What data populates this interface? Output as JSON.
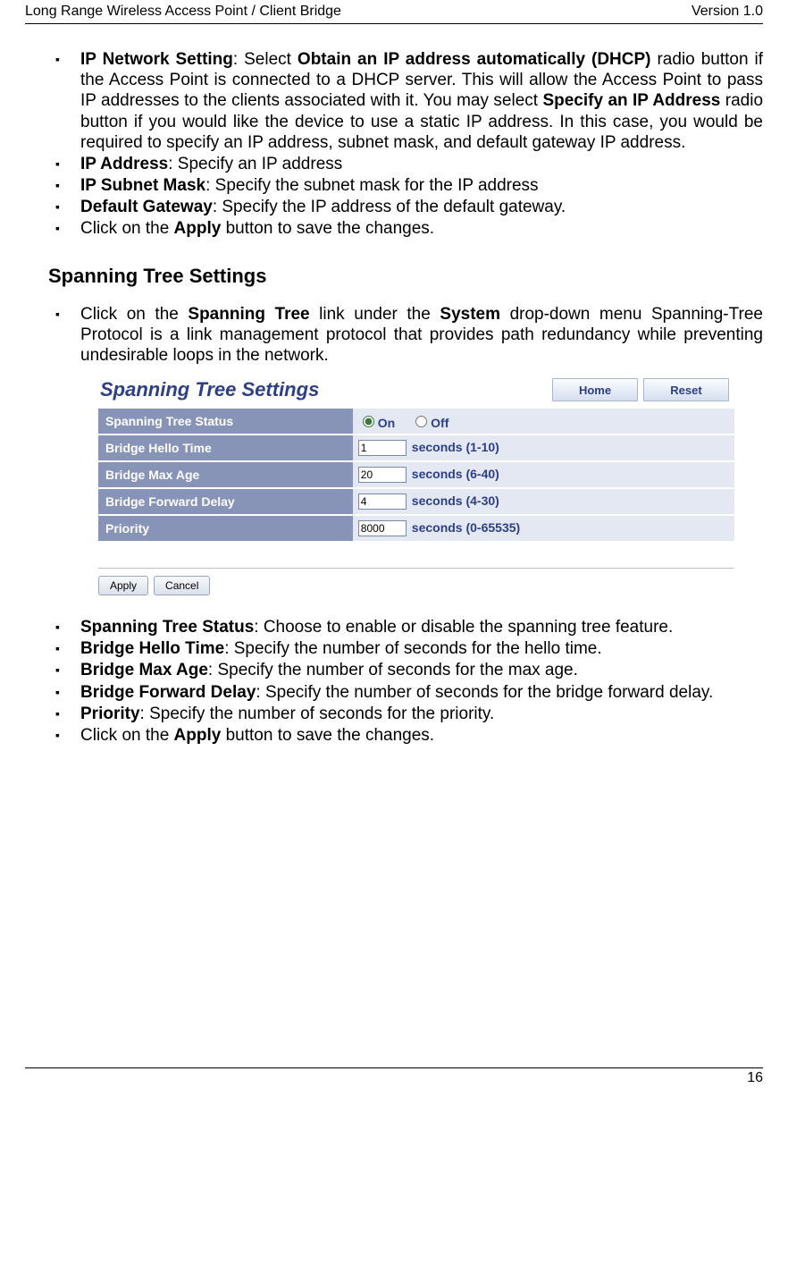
{
  "header": {
    "left": "Long Range Wireless Access Point / Client Bridge",
    "right": "Version 1.0"
  },
  "page_number": "16",
  "list1": {
    "i0": {
      "b0": "IP Network Setting",
      "t0": ": Select ",
      "b1": "Obtain an IP address automatically (DHCP)",
      "t1": " radio button if the Access Point is connected to a DHCP server. This will allow the Access Point to pass IP addresses to the clients associated with it. You may select ",
      "b2": "Specify an IP Address",
      "t2": " radio button if you would like the device to use a static IP address. In this case, you would be required to specify an IP address, subnet mask, and default gateway IP address."
    },
    "i1": {
      "b": "IP Address",
      "t": ": Specify an IP address"
    },
    "i2": {
      "b": "IP Subnet Mask",
      "t": ": Specify the subnet mask for the IP address"
    },
    "i3": {
      "b": "Default Gateway",
      "t": ": Specify the IP address of the default gateway."
    },
    "i4": {
      "t0": "Click on the ",
      "b": "Apply",
      "t1": " button to save the changes."
    }
  },
  "section_title": "Spanning Tree Settings",
  "list2": {
    "i0": {
      "t0": "Click on the ",
      "b0": "Spanning Tree",
      "t1": " link under the ",
      "b1": "System",
      "t2": " drop-down menu Spanning-Tree Protocol is a link management protocol that provides path redundancy while preventing undesirable loops in the network."
    }
  },
  "shot": {
    "title": "Spanning Tree Settings",
    "btn_home": "Home",
    "btn_reset": "Reset",
    "rows": {
      "r0": {
        "lbl": "Spanning Tree Status",
        "on": "On",
        "off": "Off"
      },
      "r1": {
        "lbl": "Bridge Hello Time",
        "val": "1",
        "unit": "seconds (1-10)"
      },
      "r2": {
        "lbl": "Bridge Max Age",
        "val": "20",
        "unit": "seconds (6-40)"
      },
      "r3": {
        "lbl": "Bridge Forward Delay",
        "val": "4",
        "unit": "seconds (4-30)"
      },
      "r4": {
        "lbl": "Priority",
        "val": "8000",
        "unit": "seconds (0-65535)"
      }
    },
    "btn_apply": "Apply",
    "btn_cancel": "Cancel"
  },
  "list3": {
    "i0": {
      "b": "Spanning Tree Status",
      "t": ": Choose to enable or disable the spanning tree feature."
    },
    "i1": {
      "b": "Bridge Hello Time",
      "t": ": Specify the number of seconds for the hello time."
    },
    "i2": {
      "b": "Bridge Max Age",
      "t": ": Specify the number of seconds for the max age."
    },
    "i3": {
      "b": "Bridge Forward Delay",
      "t": ": Specify the number of seconds for the bridge forward delay."
    },
    "i4": {
      "b": "Priority",
      "t": ": Specify the number of seconds for the priority."
    },
    "i5": {
      "t0": "Click on the ",
      "b": "Apply",
      "t1": " button to save the changes."
    }
  }
}
